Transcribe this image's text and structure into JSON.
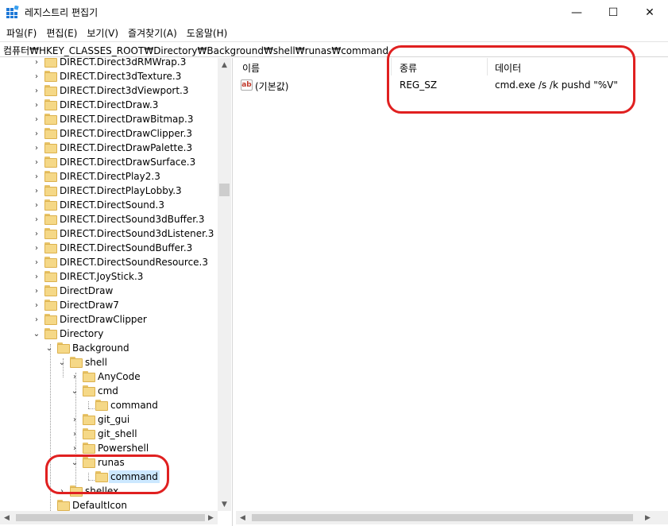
{
  "window": {
    "title": "레지스트리 편집기",
    "icon": "registry-editor-icon",
    "min_glyph": "—",
    "max_glyph": "☐",
    "close_glyph": "✕"
  },
  "menu": [
    "파일(F)",
    "편집(E)",
    "보기(V)",
    "즐겨찾기(A)",
    "도움말(H)"
  ],
  "address": "컴퓨터₩HKEY_CLASSES_ROOT₩Directory₩Background₩shell₩runas₩command",
  "tree": {
    "rows": [
      {
        "label": "DIRECT.Direct3dRMWrap.3",
        "expander": "›"
      },
      {
        "label": "DIRECT.Direct3dTexture.3",
        "expander": "›"
      },
      {
        "label": "DIRECT.Direct3dViewport.3",
        "expander": "›"
      },
      {
        "label": "DIRECT.DirectDraw.3",
        "expander": "›"
      },
      {
        "label": "DIRECT.DirectDrawBitmap.3",
        "expander": "›"
      },
      {
        "label": "DIRECT.DirectDrawClipper.3",
        "expander": "›"
      },
      {
        "label": "DIRECT.DirectDrawPalette.3",
        "expander": "›"
      },
      {
        "label": "DIRECT.DirectDrawSurface.3",
        "expander": "›"
      },
      {
        "label": "DIRECT.DirectPlay2.3",
        "expander": "›"
      },
      {
        "label": "DIRECT.DirectPlayLobby.3",
        "expander": "›"
      },
      {
        "label": "DIRECT.DirectSound.3",
        "expander": "›"
      },
      {
        "label": "DIRECT.DirectSound3dBuffer.3",
        "expander": "›"
      },
      {
        "label": "DIRECT.DirectSound3dListener.3",
        "expander": "›"
      },
      {
        "label": "DIRECT.DirectSoundBuffer.3",
        "expander": "›"
      },
      {
        "label": "DIRECT.DirectSoundResource.3",
        "expander": "›"
      },
      {
        "label": "DIRECT.JoyStick.3",
        "expander": "›"
      },
      {
        "label": "DirectDraw",
        "expander": "›"
      },
      {
        "label": "DirectDraw7",
        "expander": "›"
      },
      {
        "label": "DirectDrawClipper",
        "expander": "›"
      },
      {
        "label": "Directory",
        "expander": "⌄"
      },
      {
        "label": "Background",
        "expander": "⌄"
      },
      {
        "label": "shell",
        "expander": "⌄"
      },
      {
        "label": "AnyCode",
        "expander": "›"
      },
      {
        "label": "cmd",
        "expander": "⌄"
      },
      {
        "label": "command",
        "expander": ""
      },
      {
        "label": "git_gui",
        "expander": "›"
      },
      {
        "label": "git_shell",
        "expander": "›"
      },
      {
        "label": "Powershell",
        "expander": "›"
      },
      {
        "label": "runas",
        "expander": "⌄"
      },
      {
        "label": "command",
        "expander": "",
        "selected": true
      },
      {
        "label": "shellex",
        "expander": "›"
      },
      {
        "label": "DefaultIcon",
        "expander": ""
      }
    ]
  },
  "list": {
    "columns": [
      "이름",
      "종류",
      "데이터"
    ],
    "rows": [
      {
        "name": "(기본값)",
        "type": "REG_SZ",
        "data": "cmd.exe /s /k pushd \"%V\"",
        "icon": "string-value-icon",
        "icon_text": "ab"
      }
    ]
  },
  "scroll": {
    "up": "▲",
    "down": "▼",
    "left": "◀",
    "right": "▶"
  },
  "colors": {
    "selection": "#cce8ff",
    "annotation": "#e02020",
    "folder": "#f5d887"
  }
}
